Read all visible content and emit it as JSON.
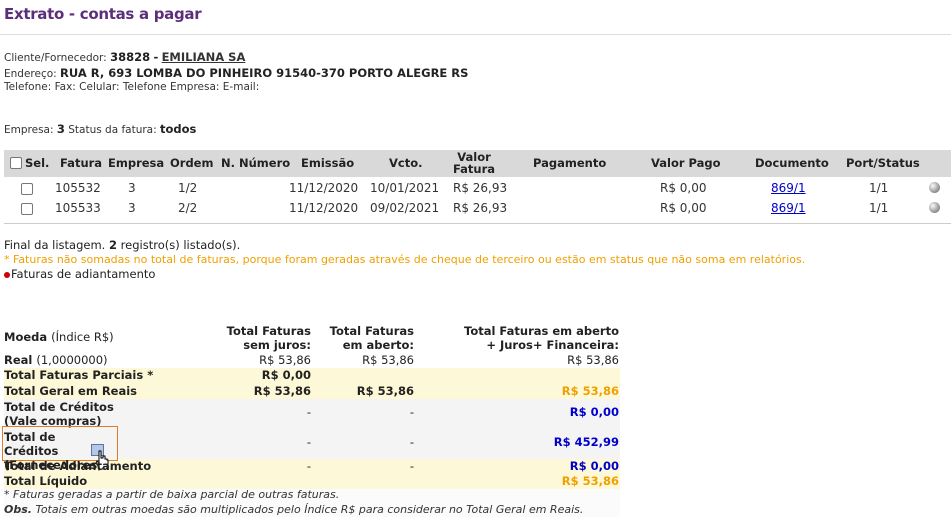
{
  "page_title": "Extrato - contas a pagar",
  "client": {
    "label": "Cliente/Fornecedor:",
    "code": "38828",
    "separator": "-",
    "name": "EMILIANA SA",
    "address_label": "Endereço:",
    "address": "RUA R, 693 LOMBA DO PINHEIRO 91540-370 PORTO ALEGRE RS",
    "contacts": "Telefone: Fax: Celular: Telefone Empresa: E-mail:"
  },
  "filters": {
    "empresa_label": "Empresa:",
    "empresa_value": "3",
    "status_label": "Status da fatura:",
    "status_value": "todos"
  },
  "table": {
    "headers": {
      "sel": "Sel.",
      "fatura": "Fatura",
      "empresa": "Empresa",
      "ordem": "Ordem",
      "numero": "N. Número",
      "emissao": "Emissão",
      "vcto": "Vcto.",
      "valor_fatura": "Valor Fatura",
      "pagamento": "Pagamento",
      "valor_pago": "Valor Pago",
      "documento": "Documento",
      "port_status": "Port/Status"
    },
    "rows": [
      {
        "fatura": "105532",
        "empresa": "3",
        "ordem": "1/2",
        "numero": "",
        "emissao": "11/12/2020",
        "vcto": "10/01/2021",
        "valor_fatura": "R$ 26,93",
        "pagamento": "",
        "valor_pago": "R$ 0,00",
        "documento": "869/1",
        "port_status": "1/1"
      },
      {
        "fatura": "105533",
        "empresa": "3",
        "ordem": "2/2",
        "numero": "",
        "emissao": "11/12/2020",
        "vcto": "09/02/2021",
        "valor_fatura": "R$ 26,93",
        "pagamento": "",
        "valor_pago": "R$ 0,00",
        "documento": "869/1",
        "port_status": "1/1"
      }
    ]
  },
  "footer": {
    "final_prefix": "Final da listagem.",
    "count": "2",
    "final_suffix": "registro(s) listado(s).",
    "warning": "* Faturas não somadas no total de faturas, porque foram geradas através de cheque de terceiro ou estão em status que não soma em relatórios.",
    "adiantamento": "Faturas de adiantamento"
  },
  "summary": {
    "headers": {
      "moeda": "Moeda",
      "indice": "(Índice R$)",
      "sem_juros": "Total Faturas sem juros:",
      "em_aberto": "Total Faturas em aberto:",
      "aberto_juros": "Total Faturas em aberto + Juros+ Financeira:"
    },
    "rows": [
      {
        "label": "Real",
        "extra": "(1,0000000)",
        "sem_juros": "R$ 53,86",
        "em_aberto": "R$ 53,86",
        "aberto_juros": "R$ 53,86"
      },
      {
        "label": "Total Faturas Parciais *",
        "sem_juros": "R$ 0,00",
        "em_aberto": "",
        "aberto_juros": ""
      },
      {
        "label": "Total Geral em Reais",
        "sem_juros": "R$ 53,86",
        "em_aberto": "R$ 53,86",
        "aberto_juros": "R$ 53,86"
      },
      {
        "label": "Total de Créditos (Vale compras)",
        "sem_juros": "-",
        "em_aberto": "-",
        "aberto_juros": "R$ 0,00"
      },
      {
        "label": "Total de Créditos (Fornecedores)",
        "sem_juros": "-",
        "em_aberto": "-",
        "aberto_juros": "R$ 452,99"
      },
      {
        "label": "Total de Adiantamento",
        "sem_juros": "-",
        "em_aberto": "-",
        "aberto_juros": "R$ 0,00"
      },
      {
        "label": "Total Líquido",
        "sem_juros": "",
        "em_aberto": "",
        "aberto_juros": "R$ 53,86"
      }
    ],
    "note1": "* Faturas geradas a partir de baixa parcial de outras faturas.",
    "obs_label": "Obs.",
    "note2": "Totais em outras moedas são multiplicados pelo Índice R$ para considerar no Total Geral em Reais."
  },
  "colors": {
    "title": "#5c2f7a",
    "header_bg": "#d9d9d9",
    "highlight_bg": "#fdf9d8",
    "orange": "#f0a000",
    "blue": "#0000cc"
  }
}
